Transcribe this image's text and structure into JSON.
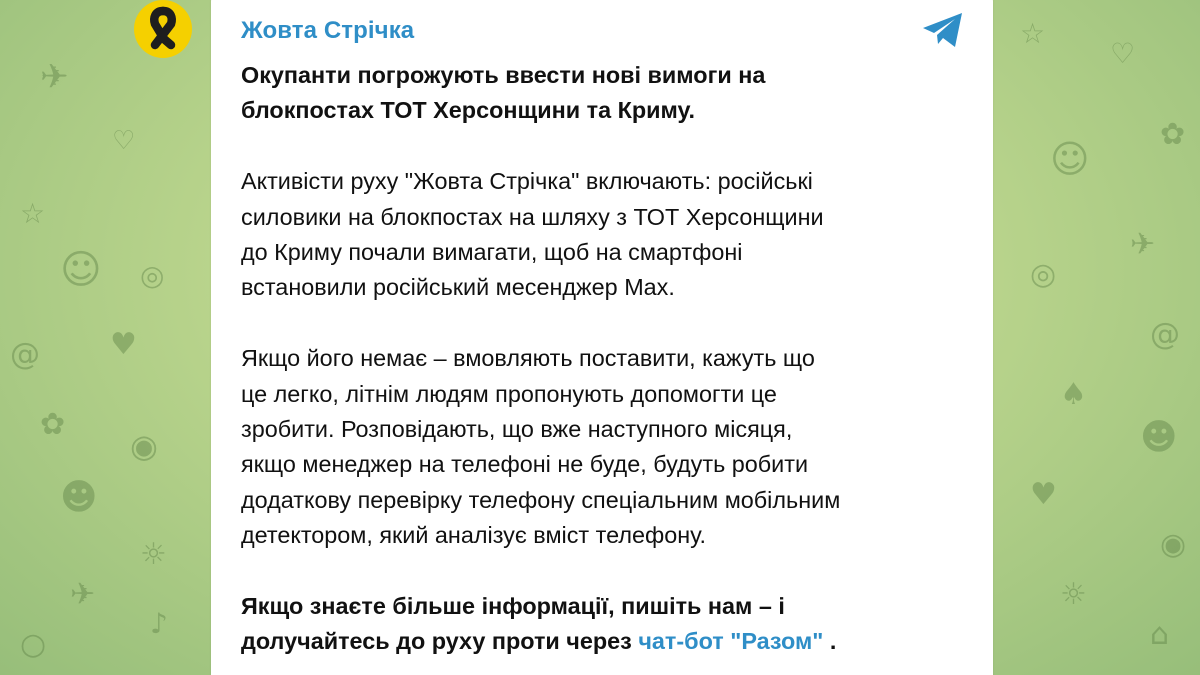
{
  "channel": {
    "name": "Жовта Стрічка",
    "avatar_icon": "yellow-ribbon-icon",
    "platform_icon": "telegram-icon",
    "accent_color": "#2f8ec7"
  },
  "message": {
    "headline_line1": "Окупанти погрожують ввести нові вимоги на",
    "headline_line2": "блокпостах ТОТ Херсонщини та Криму.",
    "p1": [
      "Активісти руху \"Жовта Стрічка\" включають: російські",
      "силовики на блокпостах на шляху з ТОТ Херсонщини",
      "до Криму почали вимагати, щоб на смартфоні",
      "встановили російський месенджер Max."
    ],
    "p2": [
      "Якщо його немає – вмовляють поставити, кажуть що",
      "це легко, літнім людям пропонують допомогти це",
      "зробити. Розповідають, що вже наступного місяця,",
      "якщо менеджер на телефоні не буде, будуть робити",
      "додаткову перевірку телефону спеціальним мобільним",
      "детектором, який аналізує вміст телефону."
    ],
    "cta_line1": "Якщо знаєте більше інформації, пишіть нам – і",
    "cta_line2_prefix": "долучайтесь до руху проти через ",
    "cta_link": "чат-бот \"Разом\"",
    "cta_line2_suffix": " ."
  }
}
